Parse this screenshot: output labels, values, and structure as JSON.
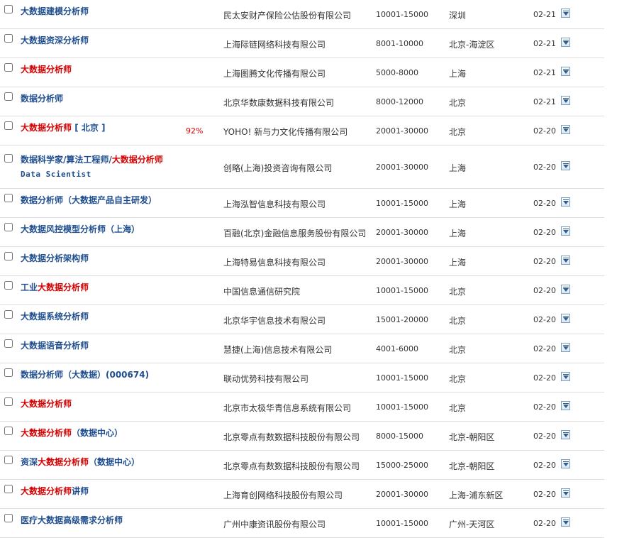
{
  "jobs": [
    {
      "title": [
        {
          "t": "大数据建模分析师",
          "hl": false
        }
      ],
      "match": "",
      "company": "民太安财产保险公估股份有限公司",
      "salary": "10001-15000",
      "location": "深圳",
      "date": "02-21"
    },
    {
      "title": [
        {
          "t": "大数据资深分析师",
          "hl": false
        }
      ],
      "match": "",
      "company": "上海际链网络科技有限公司",
      "salary": "8001-10000",
      "location": "北京-海淀区",
      "date": "02-21"
    },
    {
      "title": [
        {
          "t": "大数据分析师",
          "hl": true
        }
      ],
      "match": "",
      "company": "上海图腾文化传播有限公司",
      "salary": "5000-8000",
      "location": "上海",
      "date": "02-21"
    },
    {
      "title": [
        {
          "t": "数据分析师",
          "hl": false
        }
      ],
      "match": "",
      "company": "北京华数康数据科技有限公司",
      "salary": "8000-12000",
      "location": "北京",
      "date": "02-21"
    },
    {
      "title": [
        {
          "t": "大数据分析师",
          "hl": true
        },
        {
          "t": " [ 北京 ]",
          "hl": false
        }
      ],
      "match": "92%",
      "company": "YOHO! 新与力文化传播有限公司",
      "salary": "20001-30000",
      "location": "北京",
      "date": "02-20"
    },
    {
      "title": [
        {
          "t": "数据科学家/算法工程师/",
          "hl": false
        },
        {
          "t": "大数据分析师",
          "hl": true
        },
        {
          "t": "Data Scientist",
          "hl": false,
          "latin": true
        }
      ],
      "match": "",
      "company": "创略(上海)投资咨询有限公司",
      "salary": "20001-30000",
      "location": "上海",
      "date": "02-20",
      "tall": true
    },
    {
      "title": [
        {
          "t": "数据分析师（大数据产品自主研发）",
          "hl": false
        }
      ],
      "match": "",
      "company": "上海泓智信息科技有限公司",
      "salary": "10001-15000",
      "location": "上海",
      "date": "02-20"
    },
    {
      "title": [
        {
          "t": "大数据风控模型分析师（上海）",
          "hl": false
        }
      ],
      "match": "",
      "company": "百融(北京)金融信息服务股份有限公司",
      "salary": "20001-30000",
      "location": "上海",
      "date": "02-20"
    },
    {
      "title": [
        {
          "t": "大数据分析架构师",
          "hl": false
        }
      ],
      "match": "",
      "company": "上海特易信息科技有限公司",
      "salary": "20001-30000",
      "location": "上海",
      "date": "02-20"
    },
    {
      "title": [
        {
          "t": "工业",
          "hl": false
        },
        {
          "t": "大数据分析师",
          "hl": true
        }
      ],
      "match": "",
      "company": "中国信息通信研究院",
      "salary": "10001-15000",
      "location": "北京",
      "date": "02-20"
    },
    {
      "title": [
        {
          "t": "大数据系统分析师",
          "hl": false
        }
      ],
      "match": "",
      "company": "北京华宇信息技术有限公司",
      "salary": "15001-20000",
      "location": "北京",
      "date": "02-20"
    },
    {
      "title": [
        {
          "t": "大数据语音分析师",
          "hl": false
        }
      ],
      "match": "",
      "company": "慧捷(上海)信息技术有限公司",
      "salary": "4001-6000",
      "location": "北京",
      "date": "02-20"
    },
    {
      "title": [
        {
          "t": "数据分析师（大数据）(000674)",
          "hl": false
        }
      ],
      "match": "",
      "company": "联动优势科技有限公司",
      "salary": "10001-15000",
      "location": "北京",
      "date": "02-20"
    },
    {
      "title": [
        {
          "t": "大数据分析师",
          "hl": true
        }
      ],
      "match": "",
      "company": "北京市太极华青信息系统有限公司",
      "salary": "10001-15000",
      "location": "北京",
      "date": "02-20"
    },
    {
      "title": [
        {
          "t": "大数据分析师",
          "hl": true
        },
        {
          "t": "（数据中心）",
          "hl": false
        }
      ],
      "match": "",
      "company": "北京零点有数数据科技股份有限公司",
      "salary": "8000-15000",
      "location": "北京-朝阳区",
      "date": "02-20"
    },
    {
      "title": [
        {
          "t": "资深",
          "hl": false
        },
        {
          "t": "大数据分析师",
          "hl": true
        },
        {
          "t": "（数据中心）",
          "hl": false
        }
      ],
      "match": "",
      "company": "北京零点有数数据科技股份有限公司",
      "salary": "15000-25000",
      "location": "北京-朝阳区",
      "date": "02-20"
    },
    {
      "title": [
        {
          "t": "大数据分析师",
          "hl": true
        },
        {
          "t": "讲师",
          "hl": false
        }
      ],
      "match": "",
      "company": "上海育创网络科技股份有限公司",
      "salary": "20001-30000",
      "location": "上海-浦东新区",
      "date": "02-20"
    },
    {
      "title": [
        {
          "t": "医疗大数据高级需求分析师",
          "hl": false
        }
      ],
      "match": "",
      "company": "广州中康资讯股份有限公司",
      "salary": "10001-15000",
      "location": "广州-天河区",
      "date": "02-20"
    }
  ]
}
